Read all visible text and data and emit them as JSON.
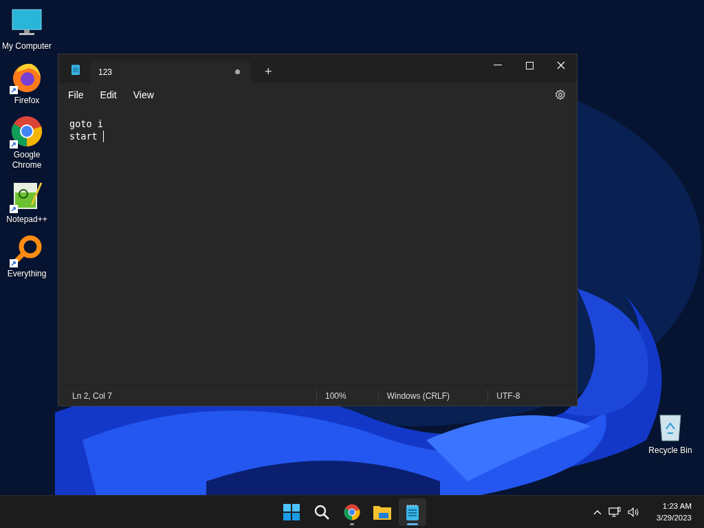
{
  "desktop_icons": [
    {
      "label": "My Computer",
      "kind": "computer",
      "shortcut": false
    },
    {
      "label": "Firefox",
      "kind": "firefox",
      "shortcut": true
    },
    {
      "label": "Google Chrome",
      "kind": "chrome",
      "shortcut": true
    },
    {
      "label": "Notepad++",
      "kind": "notepadpp",
      "shortcut": true
    },
    {
      "label": "Everything",
      "kind": "everything",
      "shortcut": true
    }
  ],
  "recycle_bin": {
    "label": "Recycle Bin"
  },
  "window": {
    "tab": {
      "title": "123",
      "modified": true
    },
    "new_tab": "+",
    "menu": [
      "File",
      "Edit",
      "View"
    ],
    "lines": [
      "goto i",
      "start "
    ],
    "status_bar": [
      "Ln 2, Col 7",
      "100%",
      "Windows (CRLF)",
      "UTF-8"
    ]
  },
  "taskbar": {
    "apps": [
      {
        "kind": "start",
        "running": false,
        "selected": false
      },
      {
        "kind": "search",
        "running": false,
        "selected": false
      },
      {
        "kind": "chrome",
        "running": true,
        "selected": false
      },
      {
        "kind": "explorer",
        "running": false,
        "selected": false
      },
      {
        "kind": "notepad",
        "running": true,
        "selected": true
      }
    ],
    "time": "1:23 AM",
    "date": "3/29/2023"
  }
}
